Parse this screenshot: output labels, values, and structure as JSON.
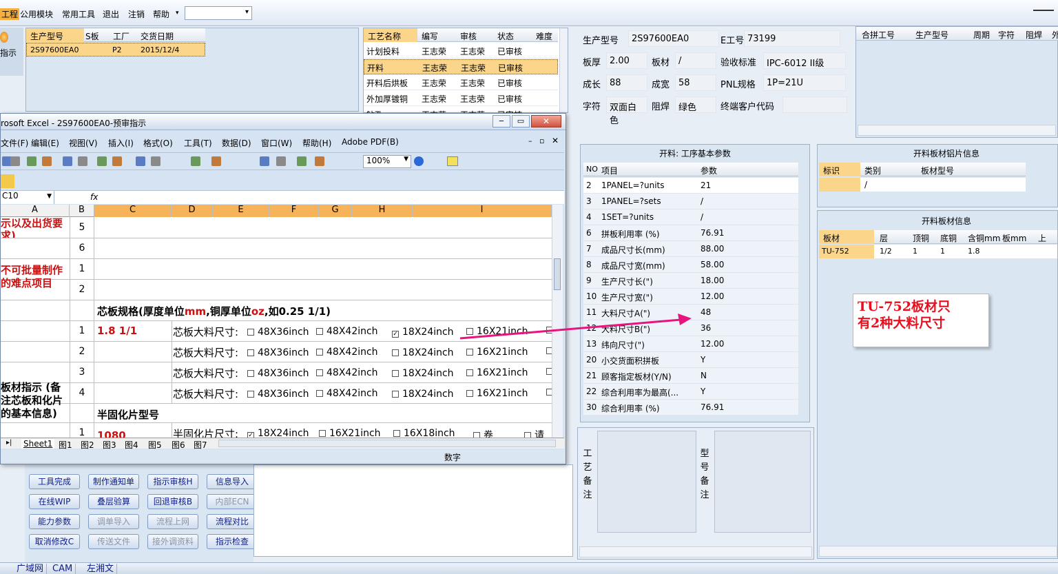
{
  "menu": {
    "items": [
      "工程",
      "公用模块",
      "常用工具",
      "退出",
      "注销",
      "帮助"
    ],
    "help_arrow": "▾"
  },
  "left": {
    "icon_label": "指示",
    "grid_headers": [
      "生产型号",
      "S板",
      "工厂",
      "交货日期"
    ],
    "grid_row": [
      "2S97600EA0",
      "P2",
      "2015/12/4"
    ]
  },
  "process": {
    "headers": [
      "工艺名称",
      "编写",
      "审核",
      "状态",
      "难度"
    ],
    "rows": [
      [
        "计划投料",
        "王志荣",
        "王志荣",
        "已审核"
      ],
      [
        "开料",
        "王志荣",
        "王志荣",
        "已审核"
      ],
      [
        "开料后烘板",
        "王志荣",
        "王志荣",
        "已审核"
      ],
      [
        "外加厚镀铜",
        "王志荣",
        "王志荣",
        "已审核"
      ],
      [
        "钻孔",
        "王志荣",
        "王志荣",
        "已审核"
      ]
    ]
  },
  "info": {
    "fields": [
      {
        "label": "生产型号",
        "value": "2S97600EA0"
      },
      {
        "label": "E工号",
        "value": "73199"
      },
      {
        "label": "板厚",
        "value": "2.00"
      },
      {
        "label": "板材",
        "value": "/"
      },
      {
        "label": "验收标准",
        "value": "IPC-6012 II级"
      },
      {
        "label": "成长",
        "value": "88"
      },
      {
        "label": "成宽",
        "value": "58"
      },
      {
        "label": "PNL规格",
        "value": "1P=21U"
      },
      {
        "label": "字符",
        "value": "双面白色"
      },
      {
        "label": "阻焊",
        "value": "绿色"
      },
      {
        "label": "终端客户代码",
        "value": ""
      }
    ],
    "merge_headers": [
      "合拼工号",
      "生产型号",
      "周期",
      "字符",
      "阻焊",
      "外"
    ]
  },
  "params": {
    "title": "开料: 工序基本参数",
    "headers": [
      "NO",
      "项目",
      "参数"
    ],
    "rows": [
      [
        "2",
        "1PANEL=?units",
        "21"
      ],
      [
        "3",
        "1PANEL=?sets",
        "/"
      ],
      [
        "4",
        "1SET=?units",
        "/"
      ],
      [
        "6",
        "拼板利用率 (%)",
        "76.91"
      ],
      [
        "7",
        "成品尺寸长(mm)",
        "88.00"
      ],
      [
        "8",
        "成品尺寸宽(mm)",
        "58.00"
      ],
      [
        "9",
        "生产尺寸长(\")",
        "18.00"
      ],
      [
        "10",
        "生产尺寸宽(\")",
        "12.00"
      ],
      [
        "11",
        "大料尺寸A(\")",
        "48"
      ],
      [
        "12",
        "大料尺寸B(\")",
        "36"
      ],
      [
        "13",
        "纬向尺寸(\")",
        "12.00"
      ],
      [
        "20",
        "小交货面积拼板",
        "Y"
      ],
      [
        "21",
        "顾客指定板材(Y/N)",
        "N"
      ],
      [
        "22",
        "综合利用率为最高(...",
        "Y"
      ],
      [
        "30",
        "综合利用率 (%)",
        "76.91"
      ]
    ]
  },
  "alu": {
    "title": "开料板材铝片信息",
    "headers": [
      "标识",
      "类别",
      "板材型号"
    ],
    "row": [
      "",
      "/",
      ""
    ]
  },
  "board": {
    "title": "开料板材信息",
    "headers": [
      "板材",
      "层",
      "顶铜",
      "底铜",
      "含铜mm",
      "板mm",
      "上"
    ],
    "row": [
      "TU-752",
      "1/2",
      "1",
      "1",
      "1.8",
      "",
      ""
    ]
  },
  "notes": {
    "proc_label": "工艺备注",
    "type_label": "型号备注"
  },
  "buttons": [
    {
      "label": "工具完成",
      "dis": false
    },
    {
      "label": "制作通知单",
      "dis": false
    },
    {
      "label": "指示审核H",
      "dis": false
    },
    {
      "label": "信息导入",
      "dis": false
    },
    {
      "label": "在线WIP",
      "dis": false
    },
    {
      "label": "叠层验算",
      "dis": false
    },
    {
      "label": "回退审核B",
      "dis": false
    },
    {
      "label": "内部ECN",
      "dis": true
    },
    {
      "label": "能力参数",
      "dis": false
    },
    {
      "label": "调单导入",
      "dis": true
    },
    {
      "label": "流程上网",
      "dis": true
    },
    {
      "label": "流程对比",
      "dis": false
    },
    {
      "label": "取消修改C",
      "dis": false
    },
    {
      "label": "传送文件",
      "dis": true
    },
    {
      "label": "接外调资料",
      "dis": true
    },
    {
      "label": "指示检查",
      "dis": false
    }
  ],
  "excel": {
    "title": "rosoft Excel - 2S97600EA0-预审指示",
    "menu": [
      "文件(F)",
      "编辑(E)",
      "视图(V)",
      "插入(I)",
      "格式(O)",
      "工具(T)",
      "数据(D)",
      "窗口(W)",
      "帮助(H)",
      "Adobe PDF(B)"
    ],
    "zoom": "100%",
    "namebox": "C10",
    "fx": "fx",
    "cols": [
      "A",
      "B",
      "C",
      "D",
      "E",
      "F",
      "G",
      "H",
      "I"
    ],
    "a_texts": [
      "示以及出货要求)",
      "不可批量制作的难点项目",
      "板材指示 (备注芯板和化片的基本信息)"
    ],
    "core_title_prefix": "芯板规格(厚度单位",
    "core_unit1": "mm",
    "core_mid": ",铜厚单位",
    "core_unit2": "oz",
    "core_suffix": ",如0.25 1/1)",
    "core_value": "1.8 1/1",
    "core_label": "芯板大料尺寸:",
    "sizes": [
      "48X36inch",
      "48X42inch",
      "18X24inch",
      "16X21inch"
    ],
    "pp_title": "半固化片型号",
    "pp_value": "1080",
    "pp_label": "半固化片尺寸:",
    "pp_sizes": [
      "18X24inch",
      "16X21inch",
      "16X18inch",
      "卷"
    ],
    "pp_last": "请",
    "row_nums": [
      "5",
      "6",
      "1",
      "2",
      "",
      "1",
      "2",
      "3",
      "4",
      "",
      "1"
    ],
    "tabs": [
      "Sheet1",
      "图1",
      "图2",
      "图3",
      "图4",
      "图5",
      "图6",
      "图7"
    ],
    "status": "数字"
  },
  "callout": {
    "text1": "TU-752板材只",
    "text2": "有2种大料尺寸"
  },
  "taskbar": [
    "广域网",
    "CAM",
    "左湘文"
  ]
}
